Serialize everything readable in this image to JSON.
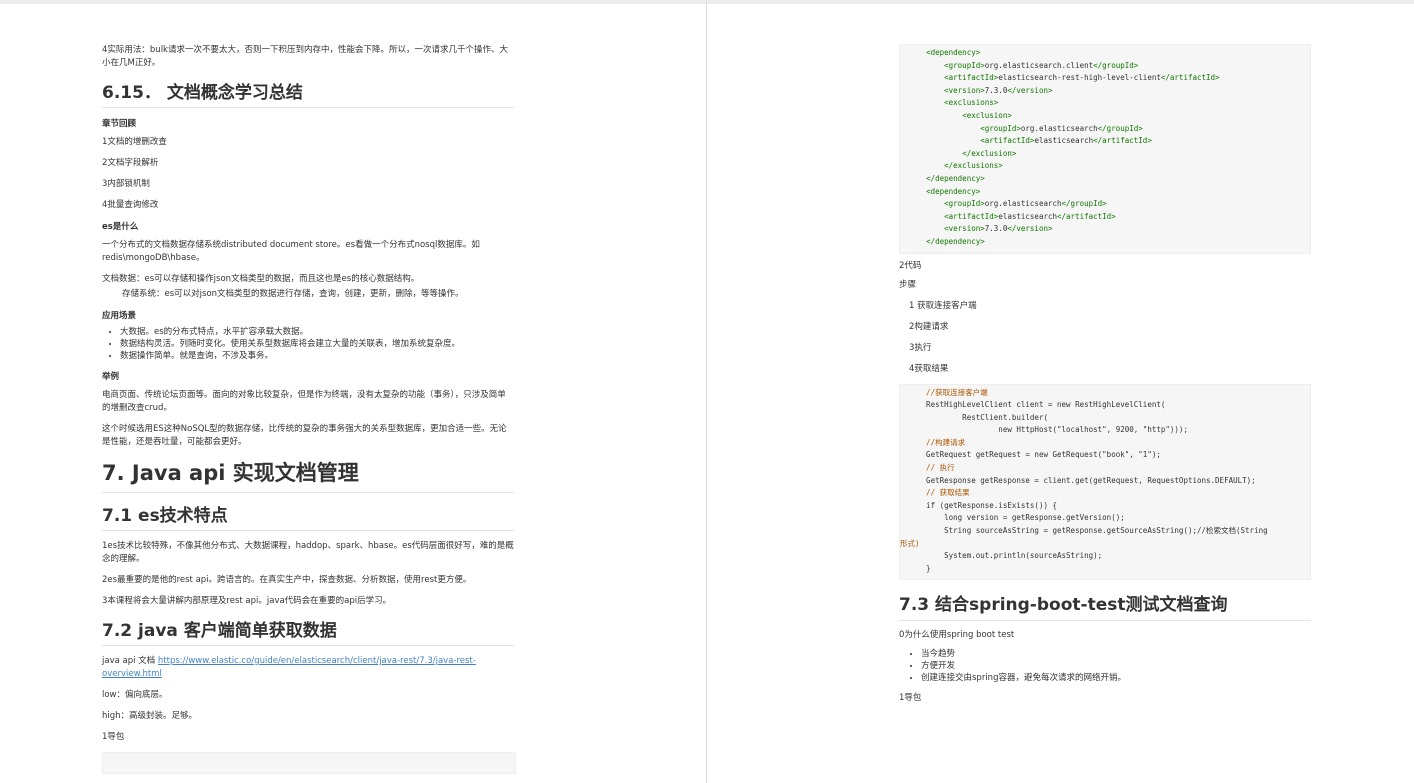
{
  "left": {
    "intro": "4实际用法：bulk请求一次不要太大，否则一下积压到内存中，性能会下降。所以，一次请求几千个操作、大小在几M正好。",
    "h_6_15": "6.15． 文档概念学习总结",
    "review_title": "章节回顾",
    "review_items": [
      "1文档的增删改查",
      "2文档字段解析",
      "3内部锁机制",
      "4批量查询修改"
    ],
    "what_title": "es是什么",
    "what_p1": "一个分布式的文档数据存储系统distributed document store。es看做一个分布式nosql数据库。如redis\\mongoDB\\hbase。",
    "what_p2": "文档数据：es可以存储和操作json文档类型的数据，而且这也是es的核心数据结构。",
    "what_p3": "存储系统：es可以对json文档类型的数据进行存储，查询，创建，更新，删除，等等操作。",
    "scene_title": "应用场景",
    "scene_items": [
      "大数据。es的分布式特点，水平扩容承载大数据。",
      "数据结构灵活。列随时变化。使用关系型数据库将会建立大量的关联表，增加系统复杂度。",
      "数据操作简单。就是查询，不涉及事务。"
    ],
    "example_title": "举例",
    "example_p1": "电商页面、传统论坛页面等。面向的对象比较复杂，但是作为终端，没有太复杂的功能（事务），只涉及简单的增删改查crud。",
    "example_p2": "这个时候选用ES这种NoSQL型的数据存储，比传统的复杂的事务强大的关系型数据库，更加合适一些。无论是性能，还是吞吐量，可能都会更好。",
    "h_7": "7. Java api 实现文档管理",
    "h_7_1": "7.1 es技术特点",
    "es_p1": "1es技术比较特殊，不像其他分布式、大数据课程，haddop、spark、hbase。es代码层面很好写，难的是概念的理解。",
    "es_p2": "2es最重要的是他的rest api。跨语言的。在真实生产中，探查数据、分析数据，使用rest更方便。",
    "es_p3": "3本课程将会大量讲解内部原理及rest api。java代码会在重要的api后学习。",
    "h_7_2": "7.2 java 客户端简单获取数据",
    "doc_prefix": "java api 文档 ",
    "doc_link": "https://www.elastic.co/guide/en/elasticsearch/client/java-rest/7.3/java-rest-overview.html",
    "low": "low：偏向底层。",
    "high": "high：高级封装。足够。",
    "import": "1导包"
  },
  "right": {
    "code_label": "2代码",
    "steps_label": "步骤",
    "steps": [
      "1 获取连接客户端",
      "2构建请求",
      "3执行",
      "4获取结果"
    ],
    "h_7_3": "7.3 结合spring-boot-test测试文档查询",
    "why": "0为什么使用spring boot test",
    "why_items": [
      "当今趋势",
      "方便开发",
      "创建连接交由spring容器，避免每次请求的网络开销。"
    ],
    "import": "1导包"
  },
  "code1_lines": [
    "    <dependency>",
    "        <groupId>org.elasticsearch.client</groupId>",
    "        <artifactId>elasticsearch-rest-high-level-client</artifactId>",
    "        <version>7.3.0</version>",
    "        <exclusions>",
    "            <exclusion>",
    "                <groupId>org.elasticsearch</groupId>",
    "                <artifactId>elasticsearch</artifactId>",
    "            </exclusion>",
    "        </exclusions>",
    "    </dependency>",
    "    <dependency>",
    "        <groupId>org.elasticsearch</groupId>",
    "        <artifactId>elasticsearch</artifactId>",
    "        <version>7.3.0</version>",
    "    </dependency>"
  ],
  "code2": {
    "c1": "    //获取连接客户端",
    "l2": "    RestHighLevelClient client = new RestHighLevelClient(",
    "l3": "            RestClient.builder(",
    "l4": "                    new HttpHost(\"localhost\", 9200, \"http\")));",
    "c5": "    //构建请求",
    "l6": "    GetRequest getRequest = new GetRequest(\"book\", \"1\");",
    "c7": "    // 执行",
    "l8": "    GetResponse getResponse = client.get(getRequest, RequestOptions.DEFAULT);",
    "c9": "    // 获取结果",
    "l10": "    if (getResponse.isExists()) {",
    "l11": "        long version = getResponse.getVersion();",
    "l12": "        String sourceAsString = getResponse.getSourceAsString();//检索文档(String",
    "l13": "形式)",
    "l14": "        System.out.println(sourceAsString);",
    "l15": "    }"
  }
}
